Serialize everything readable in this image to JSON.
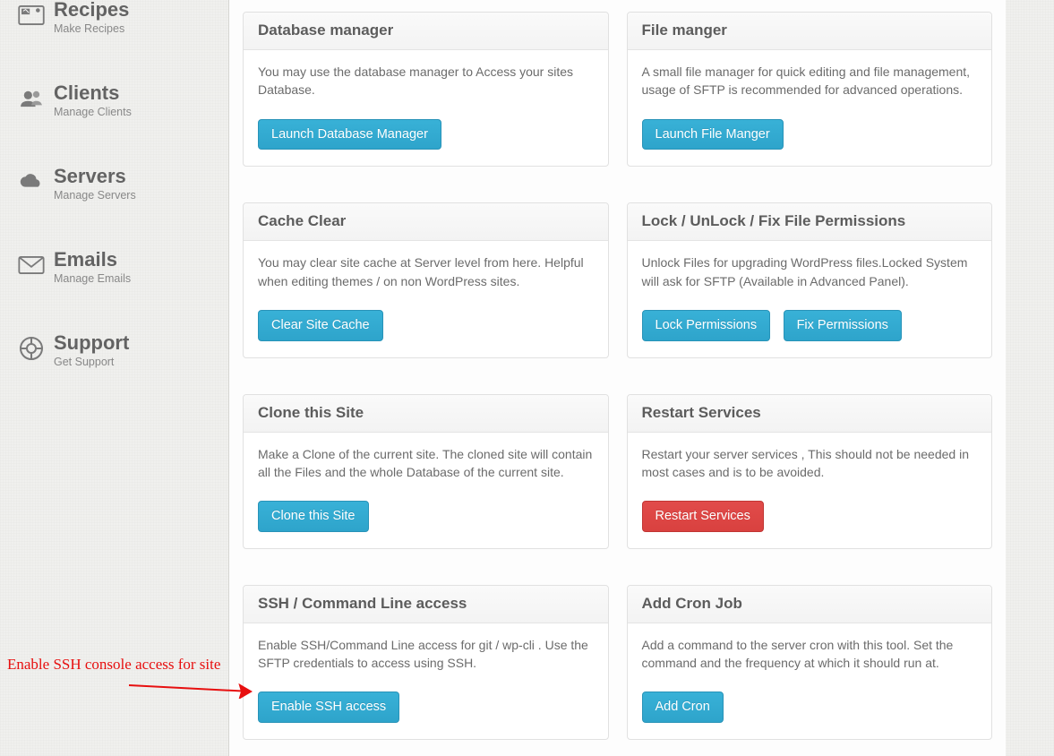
{
  "sidebar": {
    "items": [
      {
        "title": "Recipes",
        "sub": "Make Recipes",
        "icon": "recipes"
      },
      {
        "title": "Clients",
        "sub": "Manage Clients",
        "icon": "clients"
      },
      {
        "title": "Servers",
        "sub": "Manage Servers",
        "icon": "servers"
      },
      {
        "title": "Emails",
        "sub": "Manage Emails",
        "icon": "emails"
      },
      {
        "title": "Support",
        "sub": "Get Support",
        "icon": "support"
      }
    ]
  },
  "cards": {
    "database": {
      "title": "Database manager",
      "desc": "You may use the database manager to Access your sites Database.",
      "action": "Launch Database Manager"
    },
    "file": {
      "title": "File manger",
      "desc": "A small file manager for quick editing and file management, usage of SFTP is recommended for advanced operations.",
      "action": "Launch File Manger"
    },
    "cache": {
      "title": "Cache Clear",
      "desc": "You may clear site cache at Server level from here. Helpful when editing themes / on non WordPress sites.",
      "action": "Clear Site Cache"
    },
    "permissions": {
      "title": "Lock / UnLock / Fix File Permissions",
      "desc": "Unlock Files for upgrading WordPress files.Locked System will ask for SFTP (Available in Advanced Panel).",
      "action_lock": "Lock Permissions",
      "action_fix": "Fix Permissions"
    },
    "clone": {
      "title": "Clone this Site",
      "desc": "Make a Clone of the current site. The cloned site will contain all the Files and the whole Database of the current site.",
      "action": "Clone this Site"
    },
    "restart": {
      "title": "Restart Services",
      "desc": "Restart your server services , This should not be needed in most cases and is to be avoided.",
      "action": "Restart Services"
    },
    "ssh": {
      "title": "SSH / Command Line access",
      "desc": "Enable SSH/Command Line access for git / wp-cli . Use the SFTP credentials to access using SSH.",
      "action": "Enable SSH access"
    },
    "cron": {
      "title": "Add Cron Job",
      "desc": "Add a command to the server cron with this tool. Set the command and the frequency at which it should run at.",
      "action": "Add Cron"
    }
  },
  "annotation": {
    "text": "Enable SSH console access for site"
  }
}
